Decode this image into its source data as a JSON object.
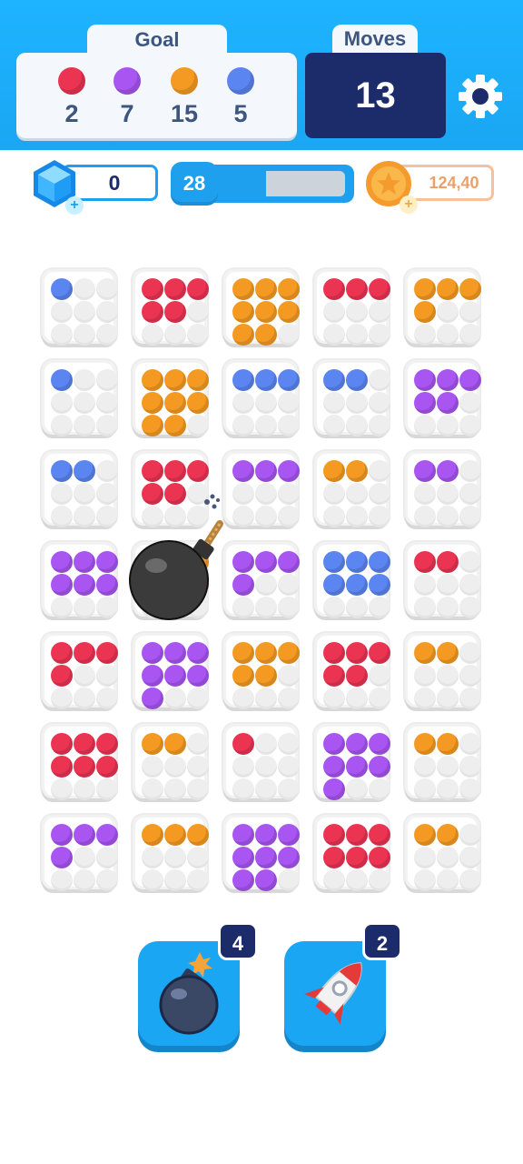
{
  "colors": {
    "red": "#ea3452",
    "purple": "#a855f1",
    "orange": "#f49a22",
    "blue": "#5b85f0",
    "header_blue": "#1eb4ff",
    "navy": "#1c2c6b"
  },
  "goal": {
    "label": "Goal",
    "items": [
      {
        "color": "red",
        "count": "2"
      },
      {
        "color": "purple",
        "count": "7"
      },
      {
        "color": "orange",
        "count": "15"
      },
      {
        "color": "blue",
        "count": "5"
      }
    ]
  },
  "moves": {
    "label": "Moves",
    "value": "13"
  },
  "settings": {
    "icon": "gear-icon"
  },
  "resources": {
    "gems": {
      "value": "0",
      "icon": "gem-icon"
    },
    "level": {
      "value": "28",
      "progress": 0.43
    },
    "coins": {
      "value": "124,40",
      "icon": "coin-icon"
    }
  },
  "board": {
    "rows": 7,
    "cols": 5,
    "tiles": [
      [
        {
          "color": "blue",
          "filled": 1
        },
        {
          "color": "red",
          "filled": 5
        },
        {
          "color": "orange",
          "filled": 8
        },
        {
          "color": "red",
          "filled": 3
        },
        {
          "color": "orange",
          "filled": 4
        }
      ],
      [
        {
          "color": "blue",
          "filled": 1
        },
        {
          "color": "orange",
          "filled": 8
        },
        {
          "color": "blue",
          "filled": 3
        },
        {
          "color": "blue",
          "filled": 2
        },
        {
          "color": "purple",
          "filled": 5
        }
      ],
      [
        {
          "color": "blue",
          "filled": 2
        },
        {
          "color": "red",
          "filled": 5
        },
        {
          "color": "purple",
          "filled": 3
        },
        {
          "color": "orange",
          "filled": 2
        },
        {
          "color": "purple",
          "filled": 2
        }
      ],
      [
        {
          "color": "purple",
          "filled": 6
        },
        {
          "color": "orange",
          "filled": 6
        },
        {
          "color": "purple",
          "filled": 4
        },
        {
          "color": "blue",
          "filled": 6
        },
        {
          "color": "red",
          "filled": 2
        }
      ],
      [
        {
          "color": "red",
          "filled": 4
        },
        {
          "color": "purple",
          "filled": 7
        },
        {
          "color": "orange",
          "filled": 5
        },
        {
          "color": "red",
          "filled": 5
        },
        {
          "color": "orange",
          "filled": 2
        }
      ],
      [
        {
          "color": "red",
          "filled": 6
        },
        {
          "color": "orange",
          "filled": 2
        },
        {
          "color": "red",
          "filled": 1
        },
        {
          "color": "purple",
          "filled": 7
        },
        {
          "color": "orange",
          "filled": 2
        }
      ],
      [
        {
          "color": "purple",
          "filled": 4
        },
        {
          "color": "orange",
          "filled": 3
        },
        {
          "color": "purple",
          "filled": 8
        },
        {
          "color": "red",
          "filled": 6
        },
        {
          "color": "orange",
          "filled": 2
        }
      ]
    ]
  },
  "boosters": [
    {
      "name": "bomb",
      "icon": "bomb-icon",
      "count": "4"
    },
    {
      "name": "rocket",
      "icon": "rocket-icon",
      "count": "2"
    }
  ]
}
